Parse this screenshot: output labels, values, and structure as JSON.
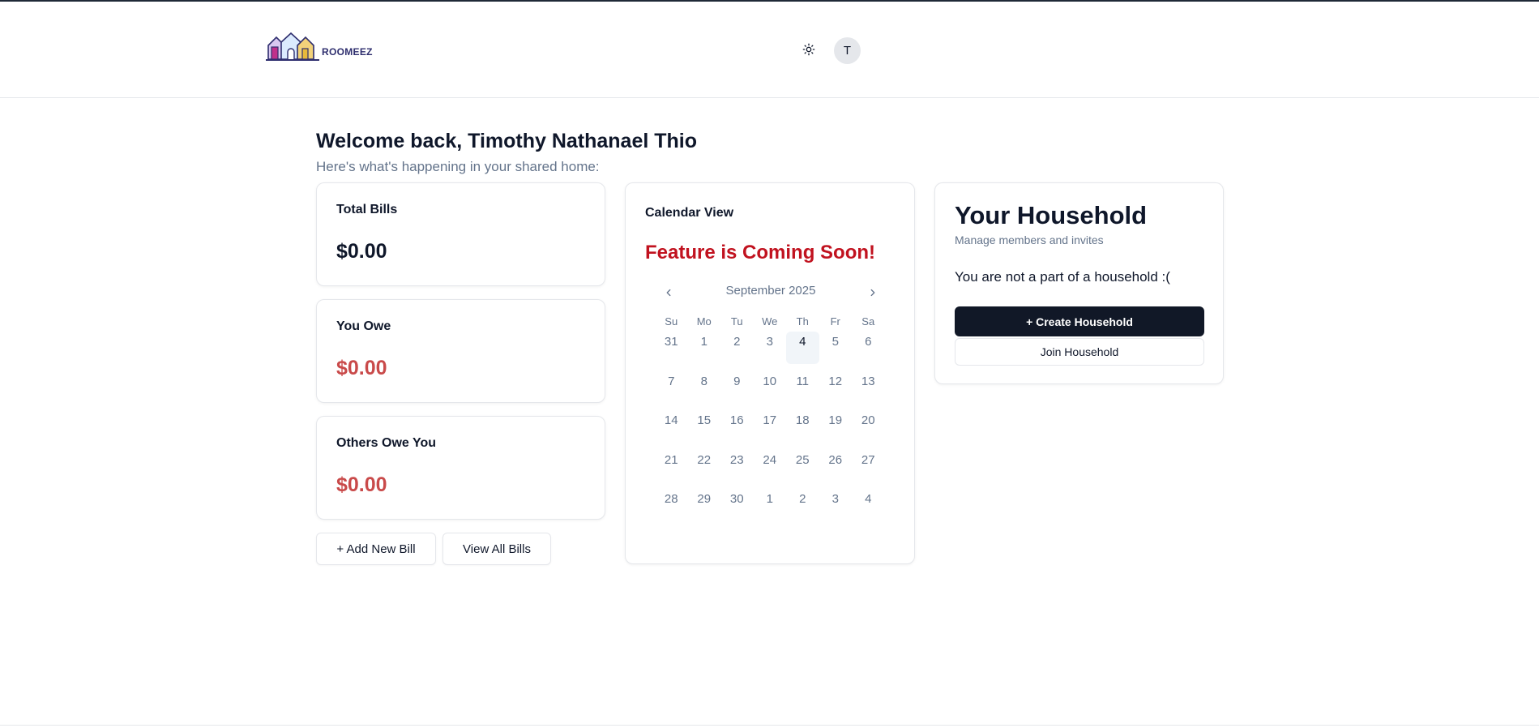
{
  "header": {
    "logo_text": "ROOMEEZ",
    "avatar_initial": "T"
  },
  "welcome": {
    "title": "Welcome back, Timothy Nathanael Thio",
    "subtitle": "Here's what's happening in your shared home:"
  },
  "stats": [
    {
      "label": "Total Bills",
      "amount": "$0.00",
      "color": "#0f172a"
    },
    {
      "label": "You Owe",
      "amount": "$0.00",
      "color": "#c94a4a"
    },
    {
      "label": "Others Owe You",
      "amount": "$0.00",
      "color": "#c94a4a"
    }
  ],
  "actions": {
    "add_bill": "+ Add New Bill",
    "view_bills": "View All Bills"
  },
  "calendar": {
    "title": "Calendar View",
    "coming_soon": "Feature is Coming Soon!",
    "month_label": "September 2025",
    "weekdays": [
      "Su",
      "Mo",
      "Tu",
      "We",
      "Th",
      "Fr",
      "Sa"
    ],
    "weeks": [
      [
        "31",
        "1",
        "2",
        "3",
        "4",
        "5",
        "6"
      ],
      [
        "7",
        "8",
        "9",
        "10",
        "11",
        "12",
        "13"
      ],
      [
        "14",
        "15",
        "16",
        "17",
        "18",
        "19",
        "20"
      ],
      [
        "21",
        "22",
        "23",
        "24",
        "25",
        "26",
        "27"
      ],
      [
        "28",
        "29",
        "30",
        "1",
        "2",
        "3",
        "4"
      ]
    ],
    "today": "4"
  },
  "household": {
    "title": "Your Household",
    "subtitle": "Manage members and invites",
    "message": "You are not a part of a household :(",
    "create_label": "+ Create Household",
    "join_label": "Join Household"
  },
  "icons": {
    "theme": "sun-icon",
    "prev": "chevron-left-icon",
    "next": "chevron-right-icon",
    "logo": "houses-logo-icon"
  },
  "colors": {
    "primary_dark": "#111827",
    "coming_soon_red": "#c1121f",
    "owe_red": "#c94a4a",
    "muted": "#64748b"
  }
}
